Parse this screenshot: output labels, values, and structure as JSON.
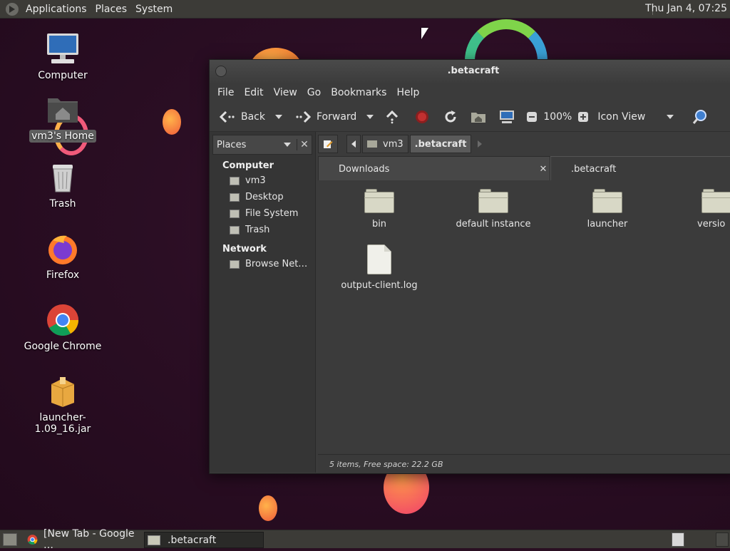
{
  "top_panel": {
    "menus": [
      "Applications",
      "Places",
      "System"
    ],
    "clock": "Thu Jan  4, 07:25"
  },
  "desktop": {
    "icons": [
      {
        "label": "Computer",
        "icon": "computer-icon"
      },
      {
        "label": "vm3's Home",
        "icon": "home-folder-icon",
        "selected": true
      },
      {
        "label": "Trash",
        "icon": "trash-icon"
      },
      {
        "label": "Firefox",
        "icon": "firefox-icon"
      },
      {
        "label": "Google Chrome",
        "icon": "chrome-icon"
      },
      {
        "label": "launcher-1.09_16.jar",
        "icon": "jar-package-icon"
      }
    ]
  },
  "window": {
    "title": ".betacraft",
    "menu": [
      "File",
      "Edit",
      "View",
      "Go",
      "Bookmarks",
      "Help"
    ],
    "toolbar": {
      "back": "Back",
      "forward": "Forward",
      "zoom": "100%",
      "view_mode": "Icon View"
    },
    "sidebar": {
      "selector": "Places",
      "sections": [
        {
          "heading": "Computer",
          "items": [
            "vm3",
            "Desktop",
            "File System",
            "Trash"
          ]
        },
        {
          "heading": "Network",
          "items": [
            "Browse Net…"
          ]
        }
      ]
    },
    "pathbar": {
      "segments": [
        "vm3",
        ".betacraft"
      ]
    },
    "tabs": [
      {
        "label": "Downloads",
        "active": false
      },
      {
        "label": ".betacraft",
        "active": true
      }
    ],
    "files": [
      {
        "name": "bin",
        "type": "folder"
      },
      {
        "name": "default instance",
        "type": "folder"
      },
      {
        "name": "launcher",
        "type": "folder"
      },
      {
        "name": "versio",
        "type": "folder"
      },
      {
        "name": "output-client.log",
        "type": "file"
      }
    ],
    "status": "5 items, Free space: 22.2 GB"
  },
  "taskbar": {
    "tasks": [
      {
        "label": "[New Tab - Google …",
        "icon": "chrome-icon",
        "active": false
      },
      {
        "label": ".betacraft",
        "icon": "folder-icon",
        "active": true
      }
    ]
  }
}
